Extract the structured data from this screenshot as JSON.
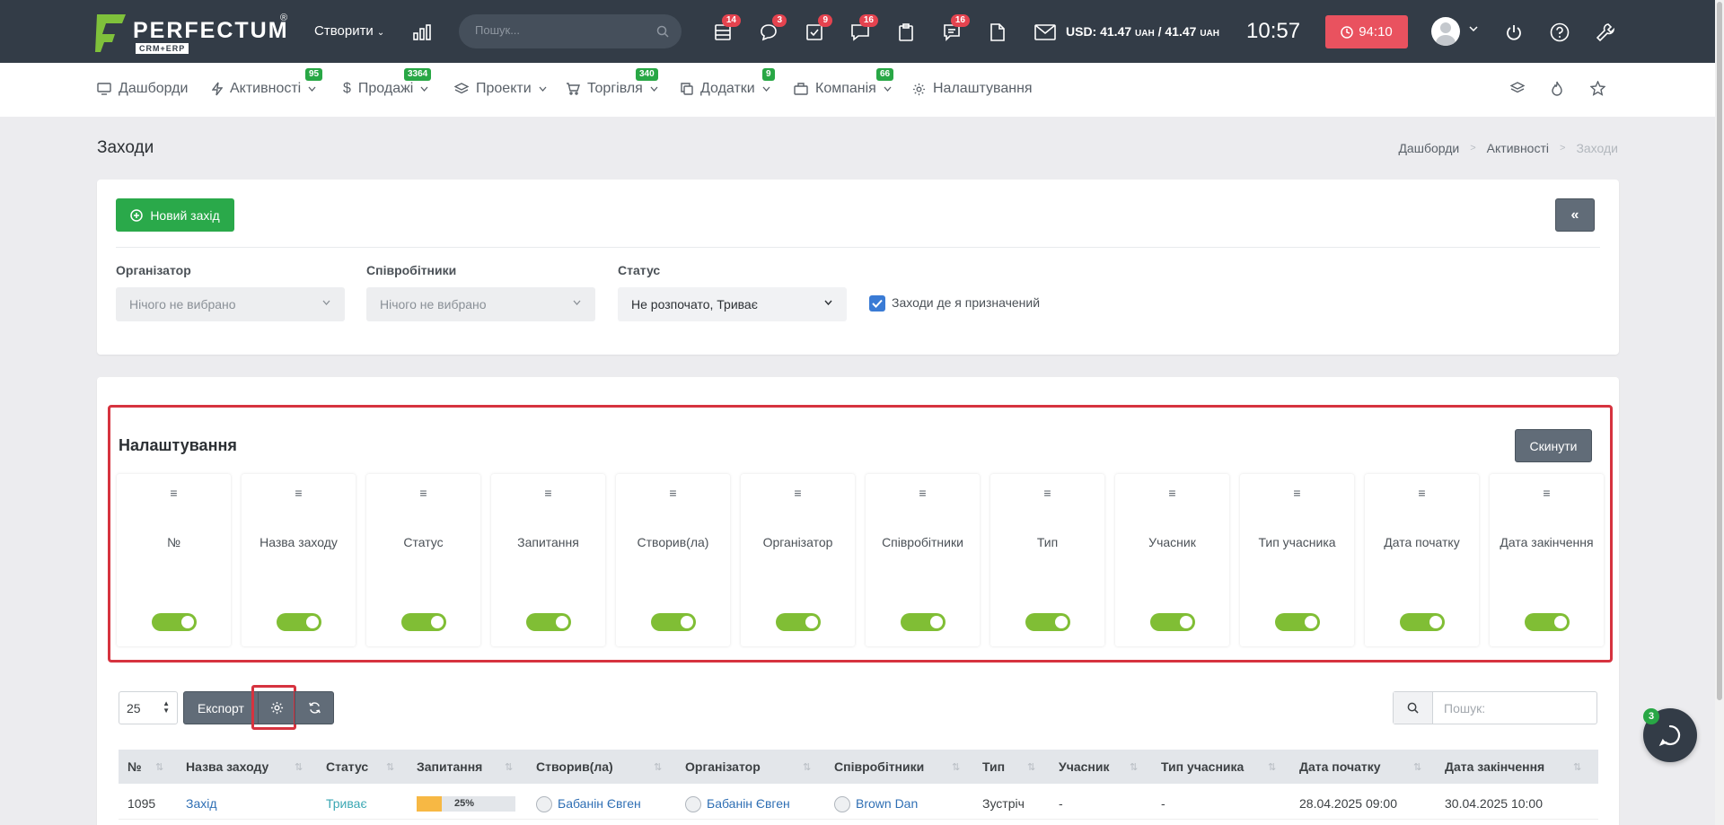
{
  "header": {
    "logo_text": "PERFECTUM",
    "logo_reg": "®",
    "logo_sub": "CRM+ERP",
    "create_label": "Створити",
    "search_placeholder": "Пошук...",
    "icons": [
      {
        "name": "list-icon",
        "badge": "14"
      },
      {
        "name": "chat-icon",
        "badge": "3"
      },
      {
        "name": "tasks-icon",
        "badge": "9"
      },
      {
        "name": "messages-icon",
        "badge": "16"
      },
      {
        "name": "clipboard-icon",
        "badge": ""
      },
      {
        "name": "comments-icon",
        "badge": "16"
      },
      {
        "name": "document-icon",
        "badge": ""
      }
    ],
    "currency_prefix": "USD: 41.47",
    "currency_unit1": "UAH",
    "currency_sep": " / 41.47 ",
    "currency_unit2": "UAH",
    "clock": "10:57",
    "timer": "94:10"
  },
  "nav": {
    "items": [
      {
        "label": "Дашборди",
        "badge": ""
      },
      {
        "label": "Активності",
        "badge": "95"
      },
      {
        "label": "Продажі",
        "badge": "3364"
      },
      {
        "label": "Проекти",
        "badge": ""
      },
      {
        "label": "Торгівля",
        "badge": "340"
      },
      {
        "label": "Додатки",
        "badge": "9"
      },
      {
        "label": "Компанія",
        "badge": "66"
      },
      {
        "label": "Налаштування",
        "badge": ""
      }
    ]
  },
  "page": {
    "title": "Заходи",
    "breadcrumb": [
      "Дашборди",
      "Активності",
      "Заходи"
    ]
  },
  "filters": {
    "new_button": "Новий захід",
    "collapse_label": "«",
    "organizer_label": "Організатор",
    "organizer_value": "Нічого не вибрано",
    "employees_label": "Співробітники",
    "employees_value": "Нічого не вибрано",
    "status_label": "Статус",
    "status_value": "Не розпочато, Триває",
    "assigned_label": "Заходи де я призначений",
    "assigned_checked": true
  },
  "settings": {
    "title": "Налаштування",
    "reset_label": "Скинути",
    "columns": [
      {
        "name": "№",
        "enabled": true
      },
      {
        "name": "Назва заходу",
        "enabled": true
      },
      {
        "name": "Статус",
        "enabled": true
      },
      {
        "name": "Запитання",
        "enabled": true
      },
      {
        "name": "Створив(ла)",
        "enabled": true
      },
      {
        "name": "Організатор",
        "enabled": true
      },
      {
        "name": "Співробітники",
        "enabled": true
      },
      {
        "name": "Тип",
        "enabled": true
      },
      {
        "name": "Учасник",
        "enabled": true
      },
      {
        "name": "Тип учасника",
        "enabled": true
      },
      {
        "name": "Дата початку",
        "enabled": true
      },
      {
        "name": "Дата закінчення",
        "enabled": true
      }
    ]
  },
  "toolbar": {
    "per_page": "25",
    "export_label": "Експорт",
    "search_placeholder": "Пошук:"
  },
  "table": {
    "headers": [
      "№",
      "Назва заходу",
      "Статус",
      "Запитання",
      "Створив(ла)",
      "Організатор",
      "Співробітники",
      "Тип",
      "Учасник",
      "Тип учасника",
      "Дата початку",
      "Дата закінчення"
    ],
    "rows": [
      {
        "id": "1095",
        "name": "Захід",
        "status": "Триває",
        "progress": "25%",
        "progress_value": 0.25,
        "creator": "Бабанін Євген",
        "organizer": "Бабанін Євген",
        "employees": "Brown Dan",
        "type": "Зустріч",
        "participant": "-",
        "participant_type": "-",
        "start": "28.04.2025 09:00",
        "end": "30.04.2025 10:00"
      }
    ]
  },
  "chat": {
    "badge": "3"
  },
  "colors": {
    "header_bg": "#333c47",
    "accent_green": "#2aa94a",
    "toggle_green": "#80be35",
    "highlight_red": "#d6333f",
    "badge_red": "#e5434f"
  }
}
